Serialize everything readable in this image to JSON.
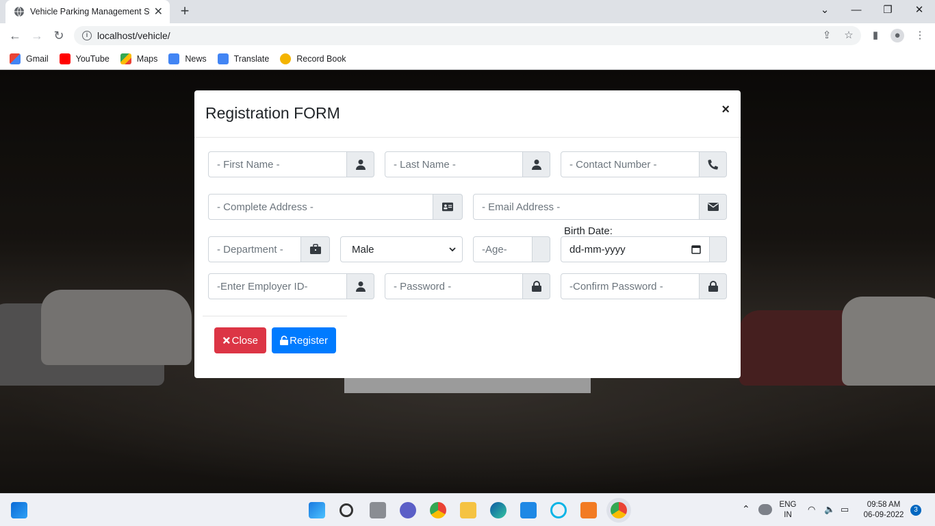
{
  "browser": {
    "tab_title": "Vehicle Parking Management Sys",
    "url": "localhost/vehicle/",
    "bookmarks": [
      "Gmail",
      "YouTube",
      "Maps",
      "News",
      "Translate",
      "Record Book"
    ]
  },
  "modal": {
    "title": "Registration FORM",
    "close_symbol": "×",
    "fields": {
      "first_name": "- First Name -",
      "last_name": "- Last Name -",
      "contact": "- Contact Number -",
      "address": "- Complete Address -",
      "email": "- Email Address -",
      "department": "- Department -",
      "gender": "Male",
      "age": "-Age-",
      "birth_label": "Birth Date:",
      "birth_date": "dd-mm-yyyy",
      "employer_id": "-Enter Employer ID-",
      "password": "- Password -",
      "confirm_password": "-Confirm Password -"
    },
    "buttons": {
      "close": "Close",
      "register": "Register"
    }
  },
  "taskbar": {
    "lang_top": "ENG",
    "lang_bottom": "IN",
    "time": "09:58 AM",
    "date": "06-09-2022",
    "notif_count": "3"
  },
  "colors": {
    "danger": "#dc3545",
    "primary": "#007bff",
    "addon_bg": "#e9ecef"
  }
}
